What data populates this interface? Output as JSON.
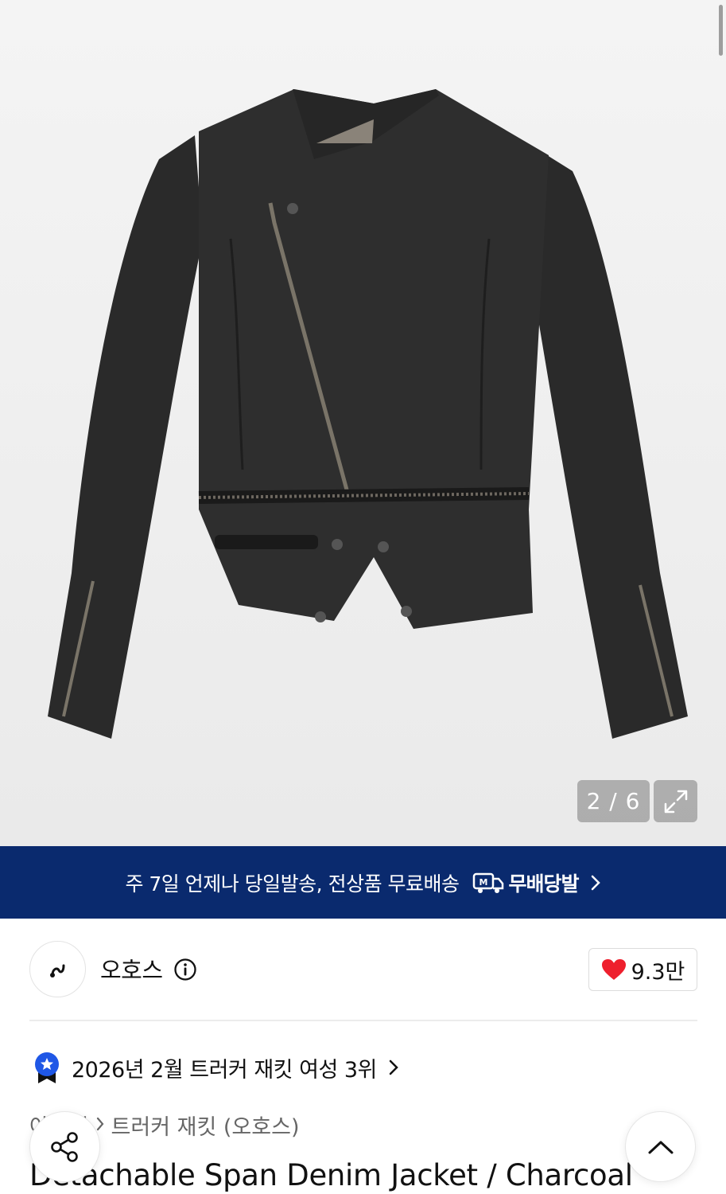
{
  "gallery": {
    "current_index": "2 / 6",
    "product_image": "charcoal-denim-jacket-photo",
    "expand_icon": "expand-icon"
  },
  "promo_banner": {
    "text": "주 7일 언제나 당일발송, 전상품 무료배송",
    "logo_label": "무배당발",
    "logo_icon": "delivery-truck-icon",
    "chevron_icon": "chevron-right-icon",
    "background_color": "#0a2a6e"
  },
  "brand": {
    "name": "오호스",
    "logo_icon": "brand-logo-icon",
    "info_icon": "info-icon",
    "likes": "9.3만",
    "like_icon": "heart-icon",
    "heart_color": "#ee1f2d"
  },
  "ranking": {
    "text": "2026년 2월 트러커 재킷 여성 3위",
    "badge_icon": "ranking-medal-icon",
    "badge_color": "#1f57e6"
  },
  "breadcrumb": {
    "parent": "아우터",
    "current": "트러커 재킷 (오호스)"
  },
  "product": {
    "title": "Detachable Span Denim Jacket / Charcoal"
  },
  "floating": {
    "share_icon": "share-icon",
    "scroll_top_icon": "chevron-up-icon"
  }
}
